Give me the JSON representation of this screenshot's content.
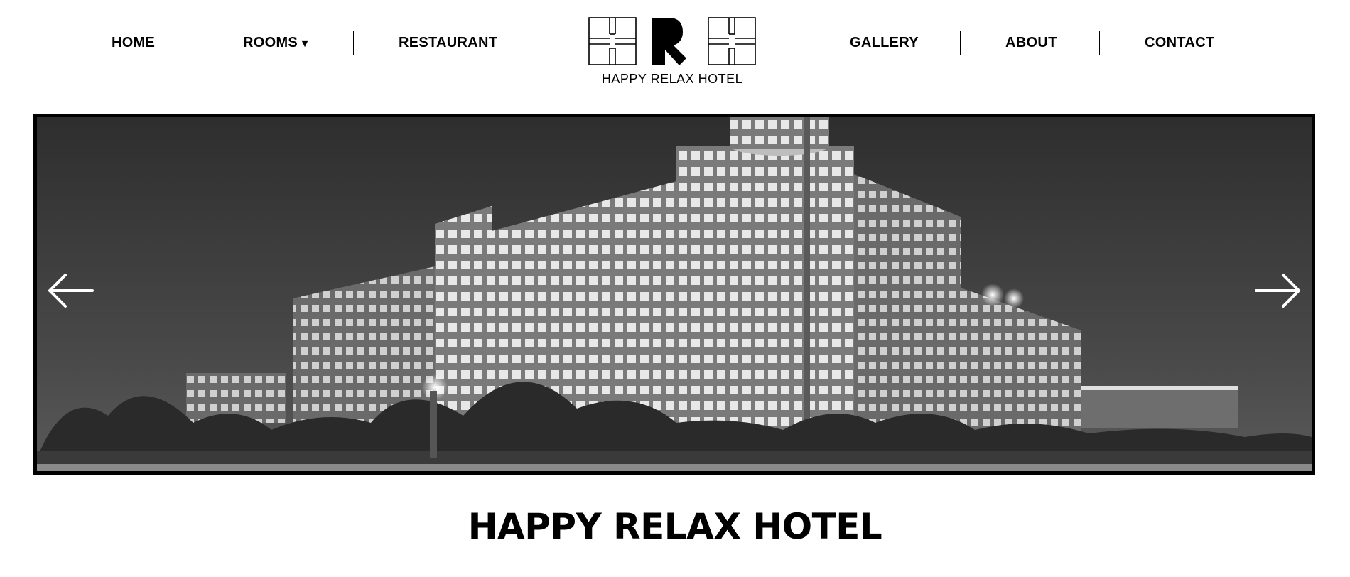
{
  "nav": {
    "left": [
      {
        "label": "HOME"
      },
      {
        "label": "ROOMS",
        "caret": "▼"
      },
      {
        "label": "RESTAURANT"
      }
    ],
    "right": [
      {
        "label": "GALLERY"
      },
      {
        "label": "ABOUT"
      },
      {
        "label": "CONTACT"
      }
    ]
  },
  "logo": {
    "letters": "HRH",
    "caption": "HAPPY RELAX HOTEL"
  },
  "slider": {
    "image": "hotel-building-night-photo",
    "prev_icon": "arrow-left-icon",
    "next_icon": "arrow-right-icon"
  },
  "main": {
    "title": "HAPPY RELAX HOTEL"
  },
  "colors": {
    "text": "#000000",
    "background": "#ffffff",
    "frame": "#000000",
    "arrow": "#ffffff"
  }
}
